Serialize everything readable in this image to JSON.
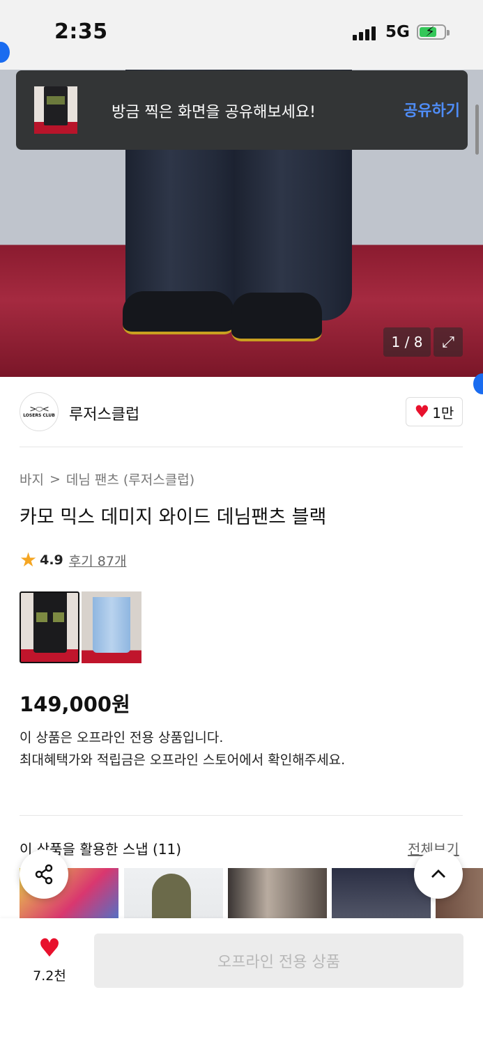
{
  "status_bar": {
    "time": "2:35",
    "network": "5G"
  },
  "toast": {
    "message": "방금 찍은 화면을 공유해보세요!",
    "action": "공유하기"
  },
  "gallery": {
    "counter": "1 / 8"
  },
  "brand": {
    "name": "루저스클럽",
    "logo_text": "LOSERS CLUB",
    "likes": "1만"
  },
  "breadcrumb": {
    "category": "바지",
    "separator": ">",
    "subcategory": "데님 팬츠 (루저스클럽)"
  },
  "product": {
    "title": "카모 믹스 데미지 와이드 데님팬츠 블랙",
    "rating": "4.9",
    "reviews": "후기 87개",
    "price": "149,000원",
    "notice_line1": "이 상품은 오프라인 전용 상품입니다.",
    "notice_line2": "최대혜택가와 적립금은 오프라인 스토어에서 확인해주세요."
  },
  "snap": {
    "title": "이 상품을 활용한 스냅 (11)",
    "view_all": "전체보기"
  },
  "bottom_bar": {
    "wish_count": "7.2천",
    "cta": "오프라인 전용 상품"
  },
  "colors": {
    "accent_blue": "#4f8df8",
    "heart_red": "#e8112d",
    "toast_bg": "#333536"
  }
}
